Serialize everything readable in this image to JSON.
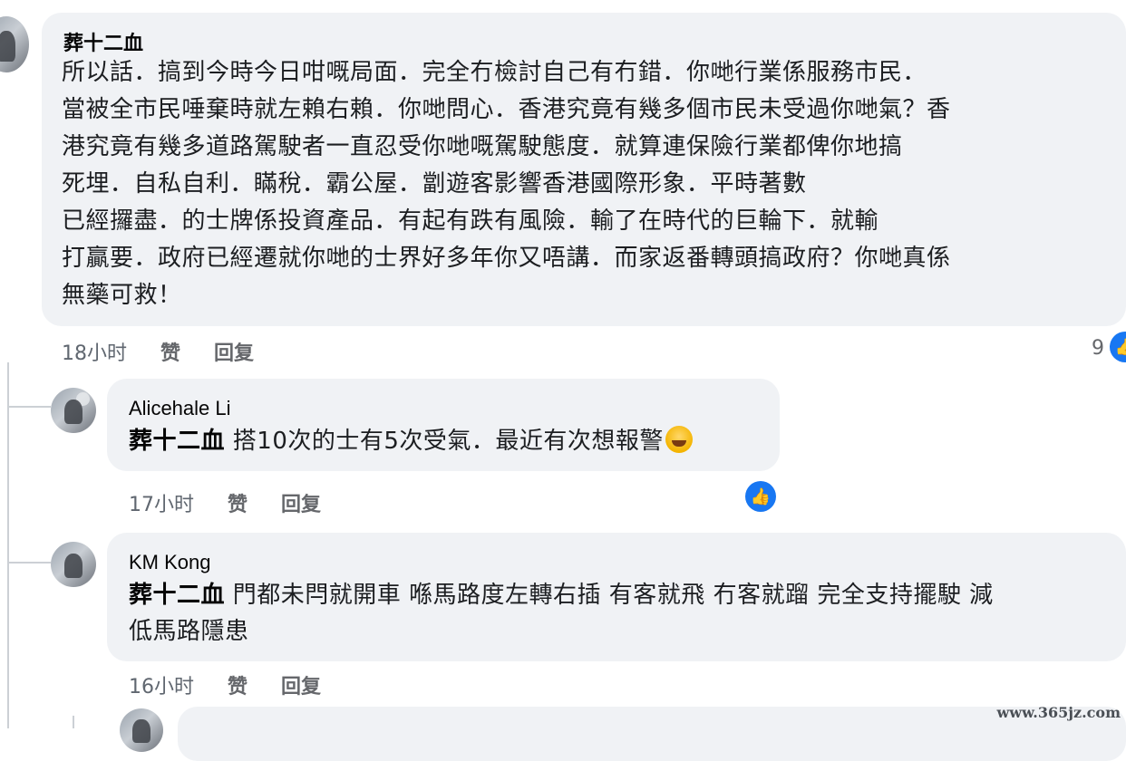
{
  "comments": [
    {
      "author": "葬十二血",
      "lines": [
        "所以話．搞到今時今日咁嘅局面．完全冇檢討自己有冇錯．￼你哋行業係服務市民．￼",
        "￼當被全市民唾棄時就左賴右賴．你哋問心．香港究竟有幾多個市民未受過你哋氣？香",
        "港究竟有幾多道路駕駛者￼￼一直忍受你哋嘅駕駛態度．￼就算連保險行業都俾你地搞",
        "死埋．￼自私自利．瞞￼稅．霸公屋￼￼．劏遊客￼影響香港國際形象．￼平時著數",
        "已經攞盡．的士牌係投資產品．有起有跌有風險￼￼￼．輸了在時代的巨輪下．￼就輸",
        "打贏要．政府已經遷就你哋的士界好多年￼你又唔講．而家返番轉頭搞政府？你哋真係",
        "無藥可救！￼￼￼￼￼"
      ],
      "time": "18小时",
      "like": "赞",
      "reply": "回复",
      "reaction_count": "9"
    },
    {
      "author": "Alicehale Li",
      "mention": "葬十二血",
      "text": "搭10次的士有5次受氣．最近有次想報警",
      "emoji": "rolling-laughing-emoji",
      "time": "17小时",
      "like": "赞",
      "reply": "回复"
    },
    {
      "author": "KM Kong",
      "mention": "葬十二血",
      "line1": "門都未閂就開車 喺馬路度左轉右插 有客就飛 冇客就蹓 完全支持擺駛 減",
      "line2": "低馬路隱患",
      "time": "16小时",
      "like": "赞",
      "reply": "回复"
    }
  ],
  "watermark": "www.365jz.com"
}
